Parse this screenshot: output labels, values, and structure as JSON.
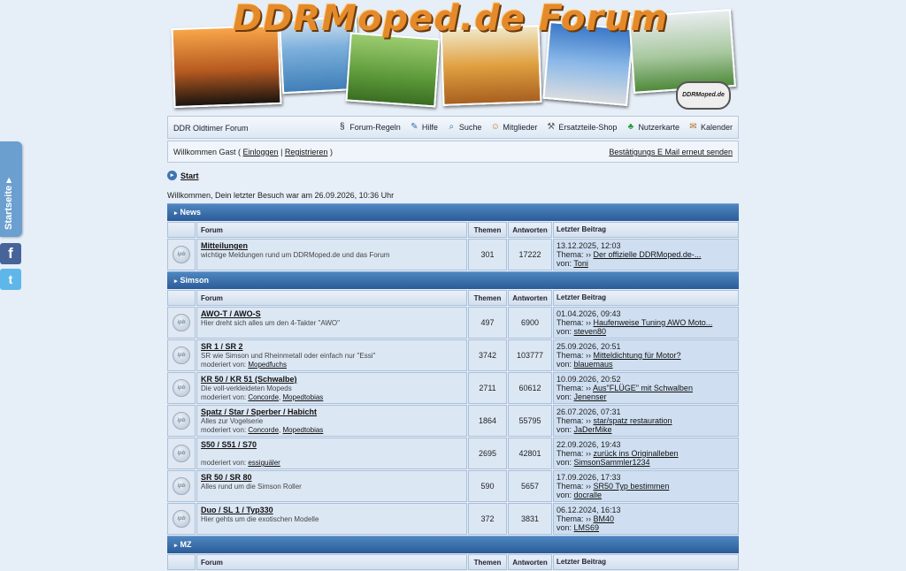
{
  "side": {
    "tab_label": "Startseite ▸",
    "facebook": "f",
    "twitter": "t"
  },
  "banner": {
    "title": "DDRMoped.de Forum",
    "logo_text": "DDRMoped.de"
  },
  "nav": {
    "site_name": "DDR Oldtimer Forum",
    "links": [
      {
        "icon": "§",
        "label": "Forum-Regeln"
      },
      {
        "icon": "✎",
        "label": "Hilfe"
      },
      {
        "icon": "⌕",
        "label": "Suche"
      },
      {
        "icon": "☺",
        "label": "Mitglieder"
      },
      {
        "icon": "⚒",
        "label": "Ersatzteile-Shop"
      },
      {
        "icon": "♣",
        "label": "Nutzerkarte"
      },
      {
        "icon": "✉",
        "label": "Kalender"
      }
    ]
  },
  "userbar": {
    "welcome_prefix": "Willkommen Gast ( ",
    "login": "Einloggen",
    "sep": " | ",
    "register": "Registrieren",
    "welcome_suffix": " )",
    "resend": "Bestätigungs E Mail erneut senden"
  },
  "breadcrumb": {
    "icon": "▸",
    "label": "Start"
  },
  "last_visit": "Willkommen, Dein letzter Besuch war am 26.09.2026, 10:36 Uhr",
  "headers": {
    "forum": "Forum",
    "topics": "Themen",
    "replies": "Antworten",
    "last": "Letzter Beitrag"
  },
  "labels": {
    "thema": "Thema: ",
    "von": "von: ",
    "moderiert": "moderiert von: ",
    "ipb": "ipb"
  },
  "categories": {
    "news": {
      "title": "News",
      "forums": [
        {
          "name": "Mitteilungen",
          "desc": "wichtige Meldungen rund um DDRMoped.de und das Forum",
          "topics": "301",
          "replies": "17222",
          "date": "13.12.2025, 12:03",
          "thread": "Der offizielle DDRMoped.de-...",
          "user": "Toni"
        }
      ]
    },
    "simson": {
      "title": "Simson",
      "forums": [
        {
          "name": "AWO-T / AWO-S",
          "desc": "Hier dreht sich alles um den 4-Takter \"AWO\"",
          "topics": "497",
          "replies": "6900",
          "date": "01.04.2026, 09:43",
          "thread": "Haufenweise Tuning AWO Moto...",
          "user": "steven80"
        },
        {
          "name": "SR 1 / SR 2",
          "desc": "SR wie Simson und Rheinmetall oder einfach nur \"Essi\"",
          "mods": [
            "Mopedfuchs"
          ],
          "topics": "3742",
          "replies": "103777",
          "date": "25.09.2026, 20:51",
          "thread": "Mitteldichtung für Motor?",
          "user": "blauemaus"
        },
        {
          "name": "KR 50 / KR 51 (Schwalbe)",
          "desc": "Die voll-verkleideten Mopeds",
          "mods": [
            "Concorde",
            "Mopedtobias"
          ],
          "topics": "2711",
          "replies": "60612",
          "date": "10.09.2026, 20:52",
          "thread": "Aus\"FLÜGE\" mit Schwalben",
          "user": "Jenenser"
        },
        {
          "name": "Spatz / Star / Sperber / Habicht",
          "desc": "Alles zur Vogelserie",
          "mods": [
            "Concorde",
            "Mopedtobias"
          ],
          "topics": "1864",
          "replies": "55795",
          "date": "26.07.2026, 07:31",
          "thread": "star/spatz restauration",
          "user": "JaDerMike"
        },
        {
          "name": "S50 / S51 / S70",
          "desc": "",
          "mods": [
            "essiguäler"
          ],
          "topics": "2695",
          "replies": "42801",
          "date": "22.09.2026, 19:43",
          "thread": "zurück ins Originalleben",
          "user": "SimsonSammler1234"
        },
        {
          "name": "SR 50 / SR 80",
          "desc": "Alles rund um die Simson Roller",
          "topics": "590",
          "replies": "5657",
          "date": "17.09.2026, 17:33",
          "thread": "SR50 Typ bestimmen",
          "user": "docralle"
        },
        {
          "name": "Duo / SL 1 / Typ330",
          "desc": "Hier gehts um die exotischen Modelle",
          "topics": "372",
          "replies": "3831",
          "date": "06.12.2024, 16:13",
          "thread": "BM40",
          "user": "LMS69"
        }
      ]
    },
    "mz": {
      "title": "MZ"
    }
  },
  "colors": {
    "category_bar": "#2a5c98",
    "page_bg": "#e6eef8",
    "banner_title": "#e58a2a"
  }
}
